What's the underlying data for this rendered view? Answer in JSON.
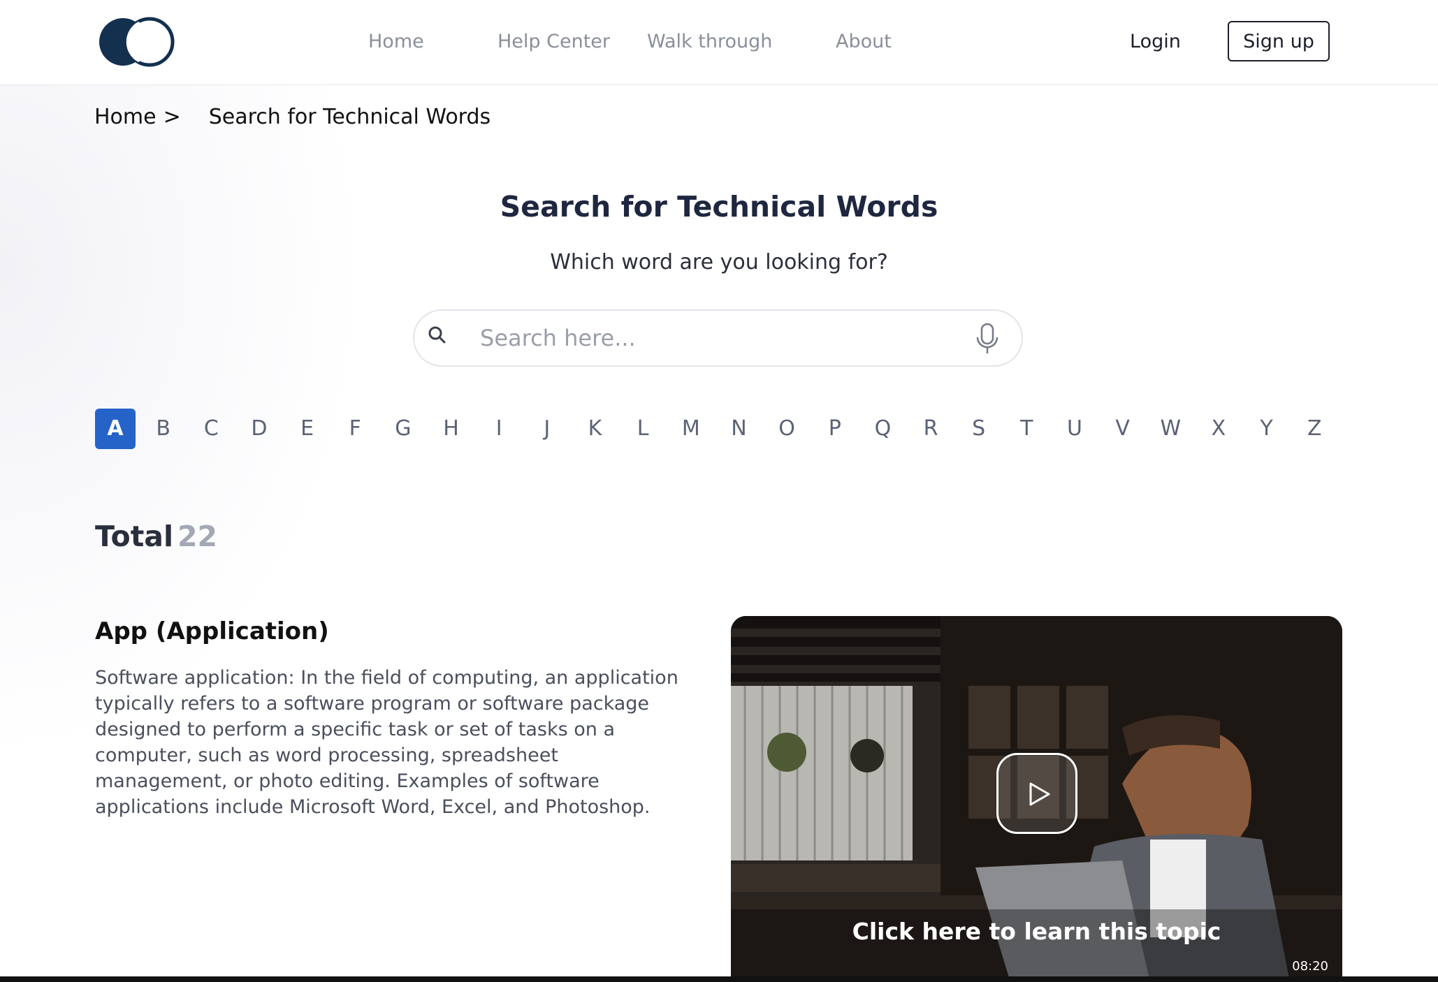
{
  "nav": {
    "links": [
      "Home",
      "Help Center",
      "Walk through",
      "About"
    ],
    "login_label": "Login",
    "signup_label": "Sign up"
  },
  "breadcrumb": {
    "home": "Home",
    "separator": ">",
    "current": "Search for Technical Words"
  },
  "hero": {
    "title": "Search for Technical Words",
    "subtitle": "Which word are you looking for?",
    "search_placeholder": "Search here..."
  },
  "alphabet": {
    "letters": [
      "A",
      "B",
      "C",
      "D",
      "E",
      "F",
      "G",
      "H",
      "I",
      "J",
      "K",
      "L",
      "M",
      "N",
      "O",
      "P",
      "Q",
      "R",
      "S",
      "T",
      "U",
      "V",
      "W",
      "X",
      "Y",
      "Z"
    ],
    "active": "A"
  },
  "results": {
    "total_label": "Total",
    "total_count": "22"
  },
  "entry": {
    "title": "App (Application)",
    "description": "Software application: In the field of computing, an application typically refers to a software program or software package designed to perform a specific task or set of tasks on a computer, such as word processing, spreadsheet management, or photo editing. Examples of software applications include Microsoft Word, Excel, and Photoshop.",
    "video": {
      "caption": "Click here to learn this topic",
      "duration": "08:20",
      "icon": "play-icon"
    }
  },
  "colors": {
    "accent": "#2563c9",
    "logo": "#14304f",
    "title": "#1f2740"
  },
  "icons": [
    "logo",
    "search-icon",
    "mic-icon",
    "play-icon"
  ]
}
